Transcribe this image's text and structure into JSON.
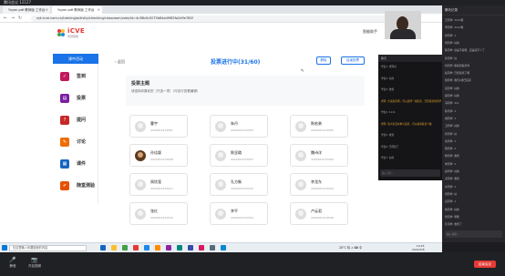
{
  "meeting": {
    "title": "腾讯会议 12127"
  },
  "browser": {
    "tabs": [
      {
        "label": "Yuyan.pdf 教师版 工作台"
      },
      {
        "label": "Yuyan.pdf 教师版 工作台"
      }
    ],
    "url": "zyk.icve.com.cn/training/activity/checking/classroom/vote/id=4c38b0c9275b84ed9f83fa2d9e780f"
  },
  "site": {
    "brand": "iCVE",
    "brand_sub": "智慧职教",
    "assistant_link": "智能助手"
  },
  "sidebar": {
    "header": "课中活动",
    "items": [
      {
        "label": "签到",
        "icon": "checkin-icon",
        "color": "#c2185b"
      },
      {
        "label": "投票",
        "icon": "vote-icon",
        "color": "#7b1fa2"
      },
      {
        "label": "提问",
        "icon": "question-icon",
        "color": "#c62828"
      },
      {
        "label": "讨论",
        "icon": "discussion-icon",
        "color": "#ef6c00"
      },
      {
        "label": "课件",
        "icon": "courseware-icon",
        "color": "#1565c0"
      },
      {
        "label": "随堂测验",
        "icon": "quiz-icon",
        "color": "#e65100"
      }
    ]
  },
  "vote": {
    "back_label": "返回",
    "title": "投票进行中(31/60)",
    "delete_label": "删除",
    "end_label": "结束投票",
    "topic_title": "投票主题",
    "topic_desc": "请选择你喜欢的（只选一项）（可自行查看编辑）"
  },
  "students": [
    {
      "name": "曹宇",
      "id": "4424321273501"
    },
    {
      "name": "朱丹",
      "id": "4424321272503"
    },
    {
      "name": "陈依勇",
      "id": "4424321272505"
    },
    {
      "name": "孙佳颖",
      "id": "4424321272508",
      "photo": true
    },
    {
      "name": "陈显璐",
      "id": "4424321272507"
    },
    {
      "name": "魏诗洋",
      "id": "4424321272509"
    },
    {
      "name": "周欣笼",
      "id": "4424321272517"
    },
    {
      "name": "孔方衡",
      "id": "4424321272519"
    },
    {
      "name": "李龙东",
      "id": "4424321272520"
    },
    {
      "name": "张红",
      "id": "4424321272522"
    },
    {
      "name": "李平",
      "id": "4424321272524"
    },
    {
      "name": "卢云君",
      "id": "4424321272526"
    }
  ],
  "chat": {
    "header": "聊天",
    "messages": [
      {
        "text": "学生1: 老师好",
        "hl": false
      },
      {
        "text": "学生2: 好的",
        "hl": false
      },
      {
        "text": "学生3: 收到",
        "hl": false
      },
      {
        "text": "老师: 大家投票吧，可以选择一项投票，已经投票的同学请等待",
        "hl": true
      },
      {
        "text": "学生4: 1111",
        "hl": false
      },
      {
        "text": "老师: 请大家及时参与投票，可以看到投票人数",
        "hl": true
      },
      {
        "text": "学生5: 收到",
        "hl": false
      },
      {
        "text": "学生6: 已经投了",
        "hl": false
      },
      {
        "text": "学生7: 好的",
        "hl": false
      }
    ],
    "input_placeholder": "输入消息..."
  },
  "right_panel": {
    "header": "聊天记录",
    "messages": [
      "王同学: 1111哦",
      "李同学: 1111哦",
      "张同学: 1",
      "周同学: 好的",
      "陈同学: 这是不投吧，还是就不少了",
      "孙同学: 好",
      "刘同学: 能看到投票吗",
      "赵同学: 已经投票了啊",
      "钱同学: 我们1组已投完",
      "吴同学: 好的",
      "郑同学: 好的",
      "冯同学: 111",
      "陈同学: 1",
      "褚同学: 1",
      "卫同学: 好的",
      "蒋同学: 好",
      "沈同学: 1",
      "韩同学: 1",
      "杨同学: 收到",
      "朱同学: 1",
      "秦同学: 好的",
      "尤同学: 收到",
      "许同学: 1",
      "何同学: 好",
      "吕同学: 1",
      "施同学: 好的",
      "张同学: 嗯嗯",
      "孔同学: 收到了"
    ],
    "input_placeholder": "输入消息..."
  },
  "taskbar": {
    "search_placeholder": "在这里输入你要搜索的内容",
    "tray": "28°C 晴 ∧ ⌨ 中",
    "time": "10:25",
    "date": "2022/3/8"
  },
  "meeting_bar": {
    "buttons": [
      {
        "label": "静音",
        "icon": "🎤"
      },
      {
        "label": "开启视频",
        "icon": "📷"
      }
    ],
    "end_label": "结束会议"
  }
}
